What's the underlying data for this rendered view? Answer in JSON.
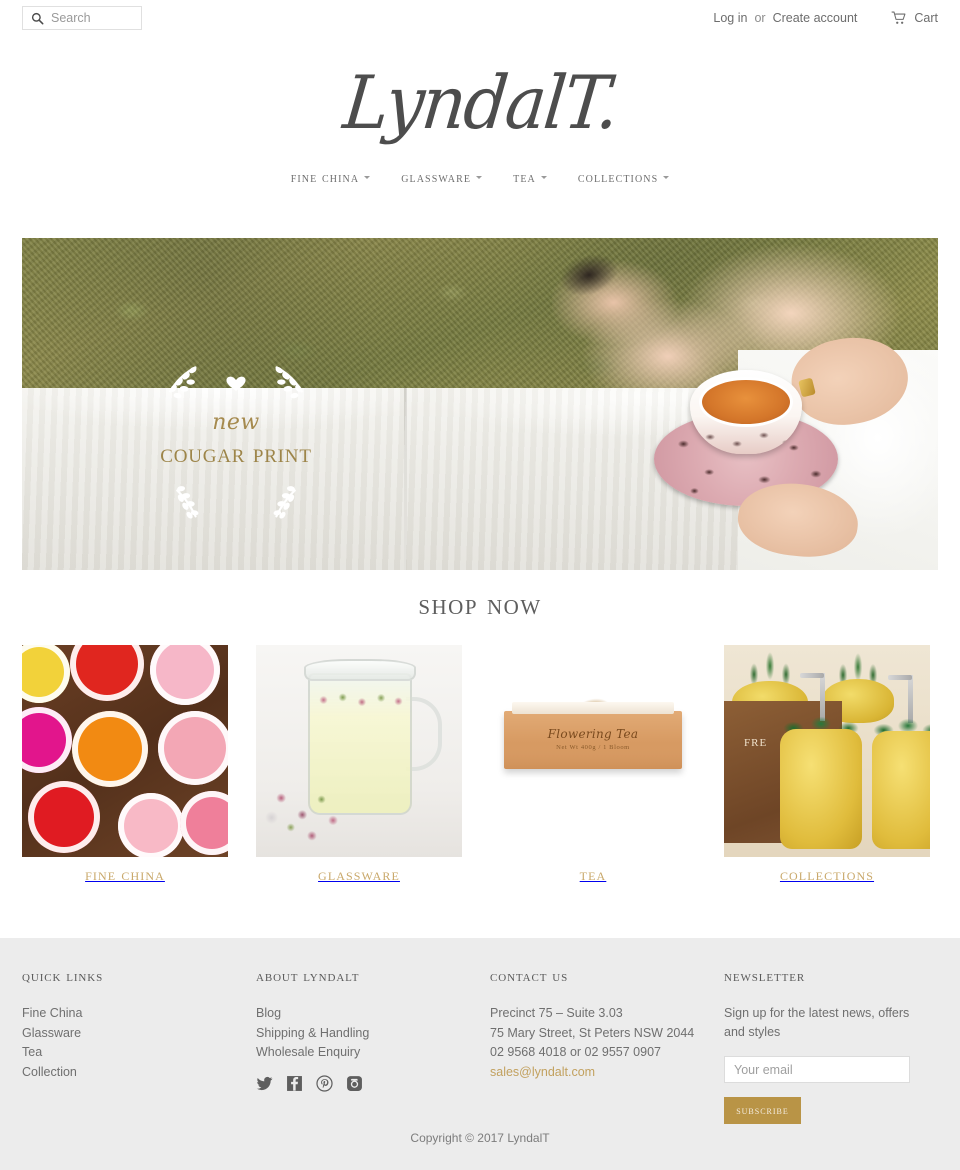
{
  "topbar": {
    "search_placeholder": "Search",
    "login_label": "Log in",
    "or_label": "or",
    "create_account_label": "Create account",
    "cart_label": "Cart"
  },
  "logo": {
    "text": "LyndalT."
  },
  "nav": {
    "items": [
      {
        "label": "Fine China"
      },
      {
        "label": "Glassware"
      },
      {
        "label": "Tea"
      },
      {
        "label": "Collections"
      }
    ]
  },
  "hero": {
    "eyebrow": "new",
    "title": "Cougar Print",
    "accent_color": "#9d8549"
  },
  "shop": {
    "heading": "Shop Now",
    "categories": [
      {
        "label": "Fine China"
      },
      {
        "label": "Glassware"
      },
      {
        "label": "Tea"
      },
      {
        "label": "Collections"
      }
    ],
    "tea_box_label": "Flowering Tea",
    "tea_box_sub": "Net Wt 400g / 1 Bloom",
    "crate_text": "FRE"
  },
  "footer": {
    "quick_links": {
      "title": "Quick Links",
      "items": [
        "Fine China",
        "Glassware",
        "Tea",
        "Collection"
      ]
    },
    "about": {
      "title": "About LyndalT",
      "items": [
        "Blog",
        "Shipping & Handling",
        "Wholesale Enquiry"
      ]
    },
    "contact": {
      "title": "Contact Us",
      "line1": "Precinct 75 – Suite 3.03",
      "line2": "75 Mary Street, St Peters NSW 2044",
      "line3": "02 9568 4018 or 02 9557 0907",
      "email": "sales@lyndalt.com"
    },
    "newsletter": {
      "title": "Newsletter",
      "text": "Sign up for the latest news, offers and styles",
      "input_placeholder": "Your email",
      "button_label": "Subscribe",
      "button_color": "#b99446"
    },
    "social": [
      "twitter-icon",
      "facebook-icon",
      "pinterest-icon",
      "instagram-icon"
    ],
    "copyright": "Copyright © 2017 LyndalT"
  }
}
